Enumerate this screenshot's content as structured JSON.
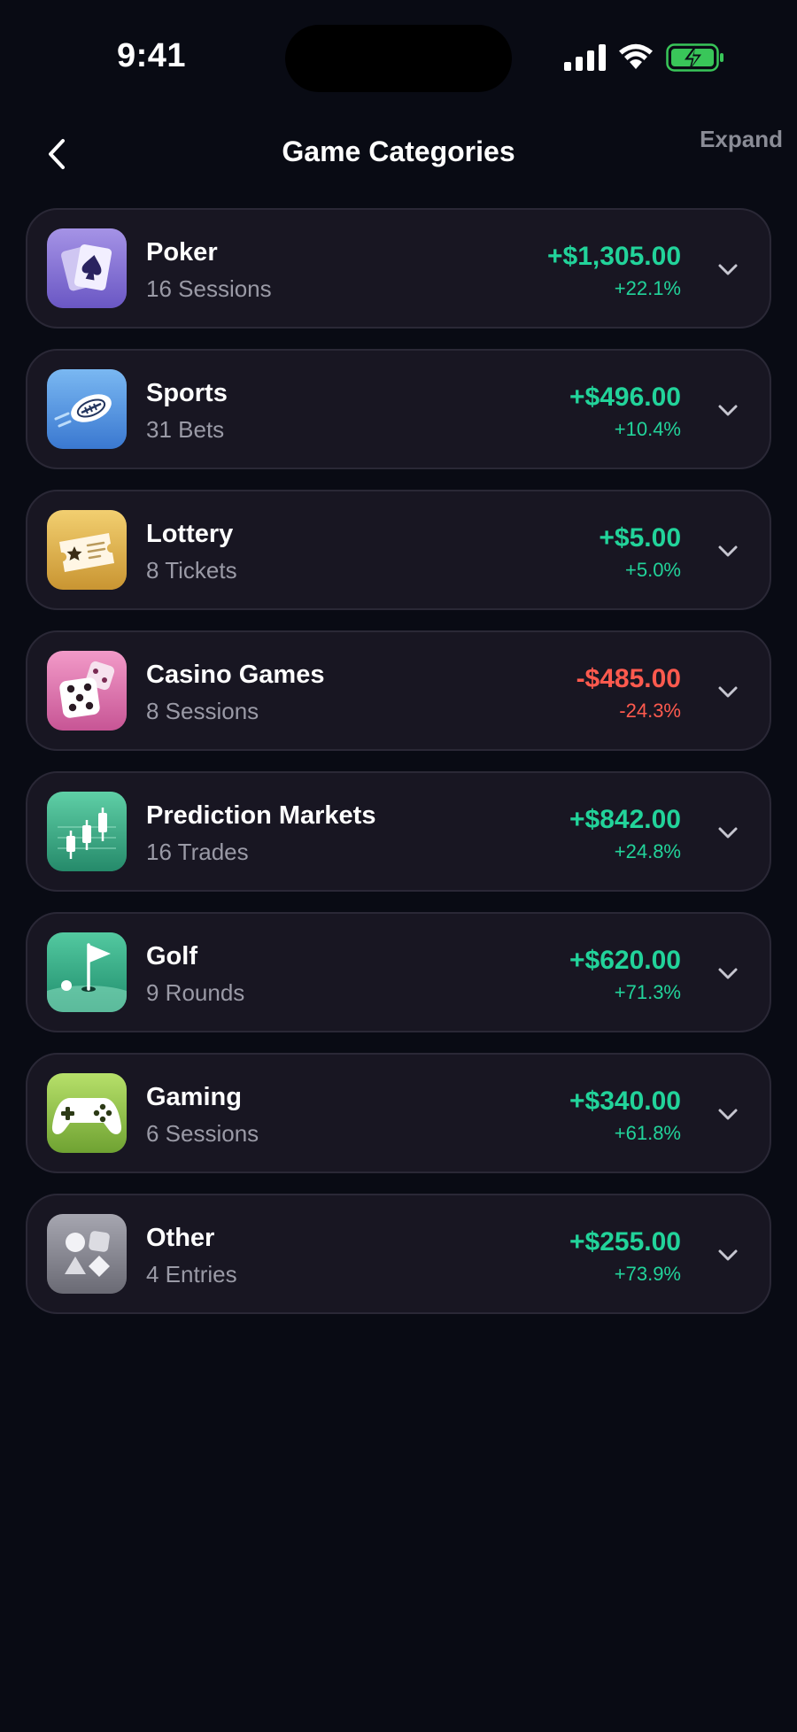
{
  "status_bar": {
    "time": "9:41"
  },
  "header": {
    "title": "Game Categories",
    "expand_label": "Expand"
  },
  "colors": {
    "positive": "#22d39a",
    "negative": "#ff5a4e",
    "card": "#181622",
    "background": "#090b14"
  },
  "categories": [
    {
      "name": "Poker",
      "count": "16 Sessions",
      "amount": "+$1,305.00",
      "change": "+22.1%",
      "trend": "positive",
      "icon": "poker-cards-icon"
    },
    {
      "name": "Sports",
      "count": "31 Bets",
      "amount": "+$496.00",
      "change": "+10.4%",
      "trend": "positive",
      "icon": "football-icon"
    },
    {
      "name": "Lottery",
      "count": "8 Tickets",
      "amount": "+$5.00",
      "change": "+5.0%",
      "trend": "positive",
      "icon": "ticket-icon"
    },
    {
      "name": "Casino Games",
      "count": "8 Sessions",
      "amount": "-$485.00",
      "change": "-24.3%",
      "trend": "negative",
      "icon": "dice-icon"
    },
    {
      "name": "Prediction Markets",
      "count": "16 Trades",
      "amount": "+$842.00",
      "change": "+24.8%",
      "trend": "positive",
      "icon": "candlestick-icon"
    },
    {
      "name": "Golf",
      "count": "9 Rounds",
      "amount": "+$620.00",
      "change": "+71.3%",
      "trend": "positive",
      "icon": "golf-flag-icon"
    },
    {
      "name": "Gaming",
      "count": "6 Sessions",
      "amount": "+$340.00",
      "change": "+61.8%",
      "trend": "positive",
      "icon": "gamepad-icon"
    },
    {
      "name": "Other",
      "count": "4 Entries",
      "amount": "+$255.00",
      "change": "+73.9%",
      "trend": "positive",
      "icon": "shapes-icon"
    }
  ]
}
